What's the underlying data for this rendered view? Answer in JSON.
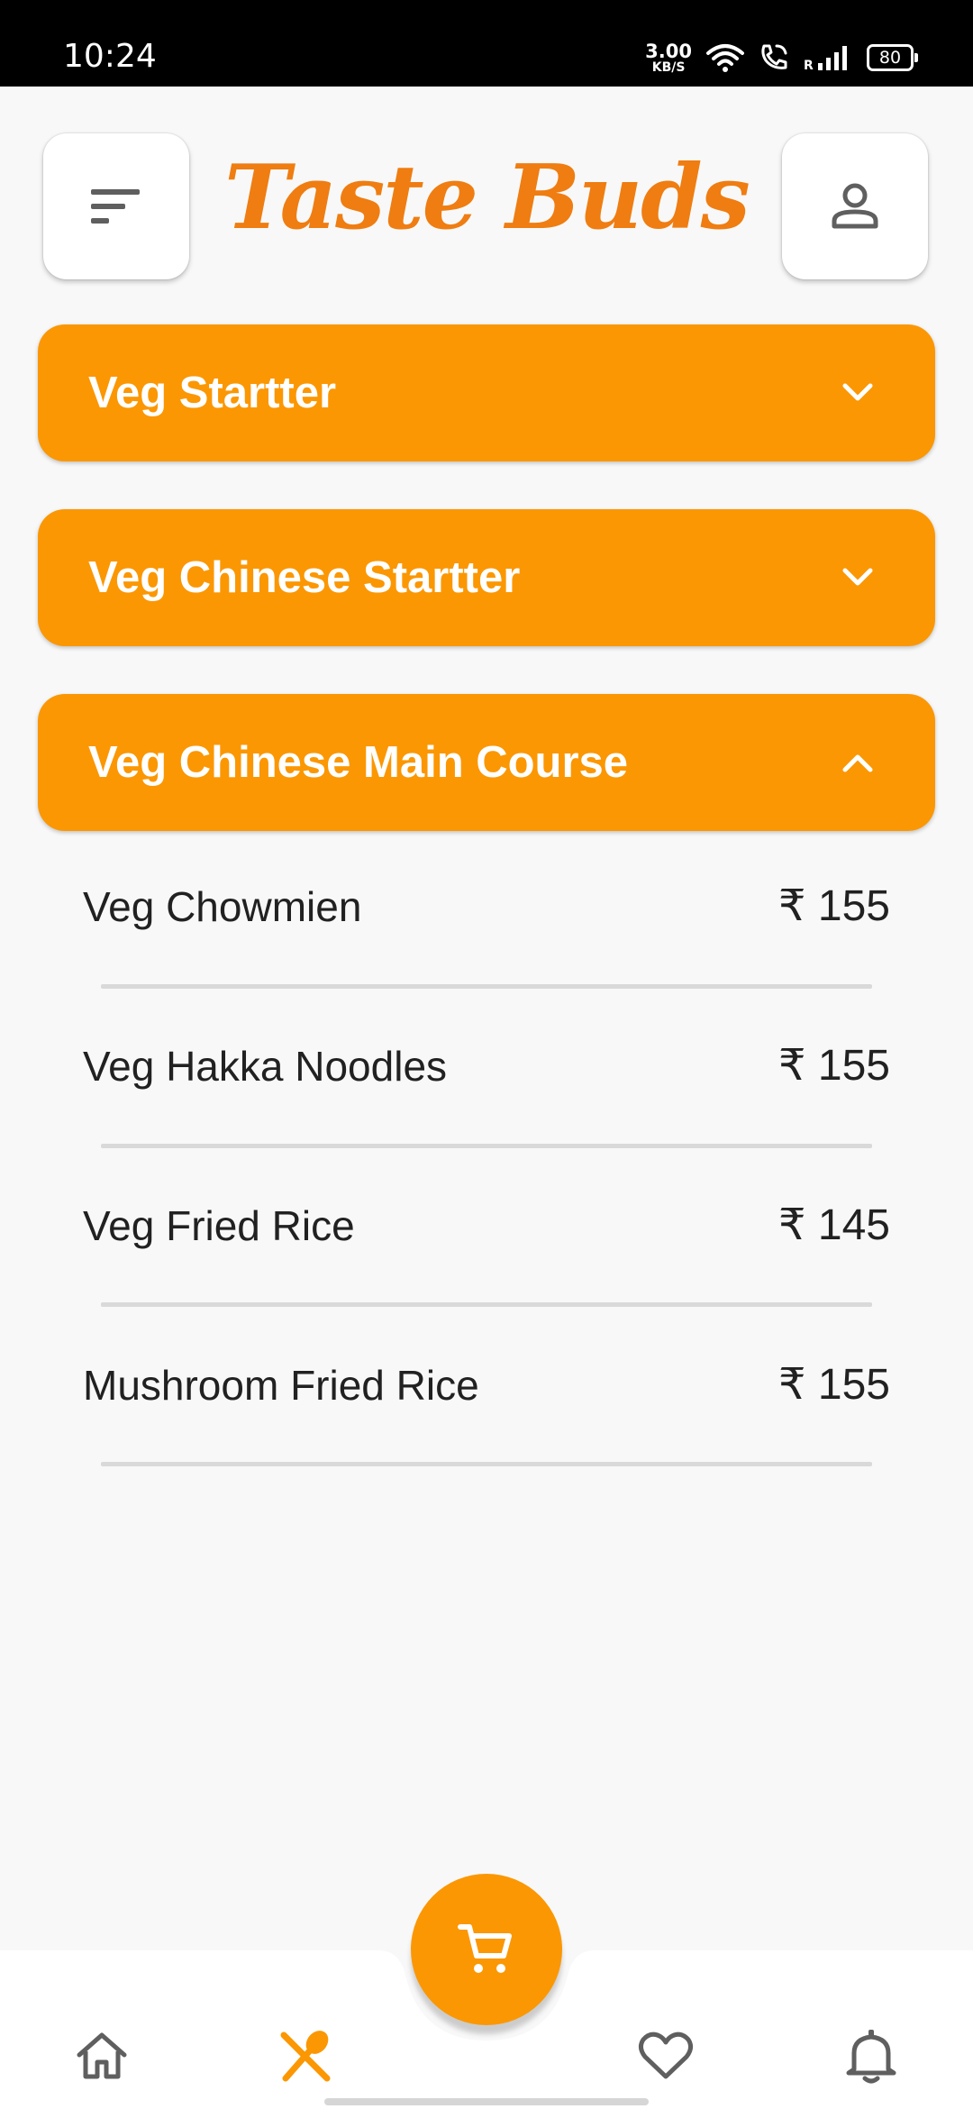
{
  "status_bar": {
    "time": "10:24",
    "speed_value": "3.00",
    "speed_unit": "KB/S",
    "battery": "80",
    "icons": [
      "wifi-icon",
      "wifi-call-icon",
      "signal-icon",
      "battery-icon"
    ]
  },
  "header": {
    "title": "Taste Buds",
    "menu_icon": "sort-menu-icon",
    "profile_icon": "person-icon"
  },
  "categories": [
    {
      "label": "Veg Startter",
      "expanded": false
    },
    {
      "label": "Veg Chinese Startter",
      "expanded": false
    },
    {
      "label": "Veg Chinese Main Course",
      "expanded": true
    }
  ],
  "menu_items": [
    {
      "name": "Veg Chowmien",
      "price": "₹ 155"
    },
    {
      "name": "Veg Hakka Noodles",
      "price": "₹ 155"
    },
    {
      "name": "Veg Fried Rice",
      "price": "₹ 145"
    },
    {
      "name": "Mushroom Fried Rice",
      "price": "₹ 155"
    }
  ],
  "bottom_nav": {
    "items": [
      "home-icon",
      "menu-cutlery-icon",
      "cart-icon",
      "heart-icon",
      "bell-icon"
    ],
    "active": "menu-cutlery-icon"
  },
  "colors": {
    "accent": "#fb9702",
    "title": "#ef7d11",
    "background": "#f8f8f8",
    "icon_gray": "#5f5f5f"
  }
}
